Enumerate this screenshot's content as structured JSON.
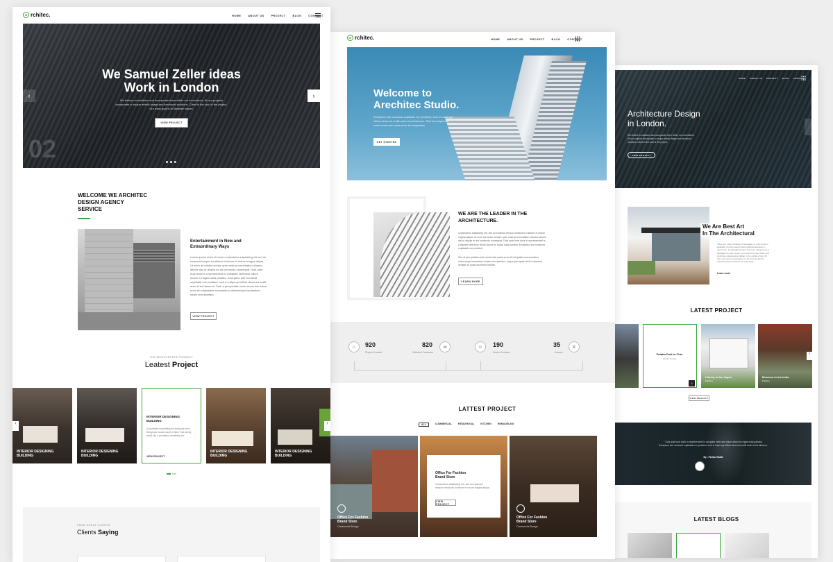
{
  "pages": {
    "left": {
      "logo": "rchitec.",
      "logo_mark": "a",
      "nav": [
        "HOME",
        "ABOUT US",
        "PROJECT",
        "BLOG",
        "CONTACT"
      ],
      "hero": {
        "title_line1": "We Samuel Zeller ideas",
        "title_line2": "Work in London",
        "text_line1": "We believe in traditions and incorporate them within our innovations. All our projects",
        "text_line2": "incorporate a unique artistic image and functional solutions. Client is the soul of the project.",
        "text_line3": "Our main goal is to illustrate values.",
        "button": "VIEW PROJECT",
        "slide_number": "02"
      },
      "welcome": {
        "title_line1": "WELCOME WE ARCHITEC",
        "title_line2": "DESIGN AGENCY",
        "title_line3": "SERVICE",
        "subtitle_line1": "Entertainment in New and",
        "subtitle_line2": "Extraordinary Ways",
        "body": "Lorem ipsum dolor sit amet consectetur adipisicing elit sed do eiusmod tempor incididunt ut labore et dolore magna aliqua Ut enim ad minim veniam quis nostrud exercitation ullamco laboris nisi ut aliquip ex ea commodo consequat. Duis aute irure dolor in reprehenderit in voluptate velit esse cillum dolore eu fugiat nulla pariatur. Excepteur sint occaecat cupidatat non proident, sunt in culpa qui officia deserunt mollit anim id est laborum. Sed ut perspiciatis unde omnis iste natus error sit voluptatem accusantium doloremque laudantium totam rem aperiam.",
        "button": "VIEW PROJECT"
      },
      "projects": {
        "kicker": "THE ARCHITECTER PRODUCT",
        "title_light": "Leatest",
        "title_bold": "Project",
        "items": [
          {
            "label": "INTERIOR DESIGNING BUILDING"
          },
          {
            "label": "INTERIOR DESIGNING BUILDING"
          },
          {
            "label": "INTERIOR DESIGNING BUILDING",
            "text": "A promises something for everyone all in this group would name is New York family that's My 4 promises something for",
            "link": "VIEW PROJECT"
          },
          {
            "label": "INTERIOR DESIGNING BUILDING"
          },
          {
            "label": "INTERIOR DESIGNING BUILDING"
          }
        ]
      },
      "clients": {
        "kicker": "FROM GREAT CLIENTS",
        "title_light": "Clients",
        "title_bold": "Saying"
      }
    },
    "middle": {
      "logo": "rchitec.",
      "logo_mark": "a",
      "nav": [
        "HOME",
        "ABOUT US",
        "PROJECT",
        "BLOG",
        "CONTACT"
      ],
      "hero": {
        "title_line1": "Welcome to",
        "title_line2": "Arechitec Studio.",
        "text_line1": "Excepteur sint occaecat cupidatat non proident, sunt in culpa qui",
        "text_line2": "officia deserunt mollit anim id est laborum. Sed ut perspiciatis",
        "text_line3": "unde omnis iste natus error sit voluptatem",
        "button": "GET STARTED"
      },
      "leader": {
        "title_line1": "WE ARE THE LEADER IN THE",
        "title_line2": "ARCHITECTURE.",
        "body1": "Consectetur adipisicing elit, sed do eiusmod tempor incididunt ut labore et dolore magna aliqua. Ut enim ad minim veniam, quis nostrud exercitation ullamco laboris nisi ut aliquip ex ea commodo consequat. Duis aute irure dolor in reprehenderit in voluptate velit esse cillum dolore eu fugiat nulla pariatur. Excepteur sint occaecat cupidatat non proident.",
        "body2": "Sed ut pers piciatis unde omnis iste natus error sit voluptatem accusantium doloremque laudantium, totam rem aperiam, eaque ipsa quae ab illo inventore veritatis et quasi architecto beatae.",
        "button": "LEARN MORE"
      },
      "stats": [
        {
          "value": "920",
          "label": "Project Created"
        },
        {
          "value": "820",
          "label": "Satisfied Costumes"
        },
        {
          "value": "190",
          "label": "Worker Number"
        },
        {
          "value": "35",
          "label": "Awards"
        }
      ],
      "projects": {
        "title": "LATTEST PROJECT",
        "filters": [
          "ALL",
          "COMMERCIAL",
          "RESIDENTIAL",
          "KITCHEN",
          "REMODELING"
        ],
        "items": [
          {
            "title_line1": "Office For Fashion",
            "title_line2": "Brand Store",
            "sub": "Commercial Design"
          },
          {
            "title_line1": "Office For Fashion",
            "title_line2": "Brand Store",
            "sub": "Consectetur adipisicing elit, sed do eiusmod tempor incididunt ut labore et dolore magna aliqua.",
            "link": "VIEW PROJECT"
          },
          {
            "title_line1": "Office For Fashion",
            "title_line2": "Brand Store",
            "sub": "Commercial Design"
          }
        ]
      }
    },
    "right": {
      "nav": [
        "HOME",
        "ABOUT US",
        "PROJECT",
        "BLOG",
        "CONTACT"
      ],
      "hero": {
        "title_line1": "Architecture Design",
        "title_line2": "in London.",
        "text_line1": "We believe in traditions and incorporate them within our innovations.",
        "text_line2": "All our projects incorporate a unique artistic image and functional",
        "text_line3": "solutions. Client is the soul of the project.",
        "button": "VIEW PROJECT"
      },
      "best_art": {
        "title_line1": "We Are Best Art",
        "title_line2": "In The Architectural",
        "body": "There are many variations of passages of Lorem Ipsum available, but the majority have suffered alteration in some form, by injected humour. If you are going to use a passage of Lorem Ipsum, you need to be sure there isn't anything embarrassing hidden in the middle of text. All the Lorem Ipsum generators on the Internet tend to repeat predefined chunks as necessary.",
        "link": "Learn more"
      },
      "projects": {
        "title": "LATEST PROJECT",
        "items": [
          {
            "title": "Futatio Park in Chin",
            "sub": "Interior Design"
          },
          {
            "title": "Library in the Japan",
            "sub": "Building"
          },
          {
            "title": "Museum in the India",
            "sub": "Building"
          }
        ],
        "button": "VIEW PROJECT"
      },
      "testimonial": {
        "quote_line1": "\" Duis aute irure dolor in reprehenderit in voluptate velit esse cillum dolore eu fugiat nulla pariatur.",
        "quote_line2": "Excepteur sint occaecat cupidatat non proident, sunt in culpa qui officia deserunt mollit anim id est laborum.",
        "author": "By : Farhan Rakib"
      },
      "blogs": {
        "title": "LATEST BLOGS"
      }
    }
  },
  "colors": {
    "accent": "#3aa53a",
    "dark": "#1f2226",
    "blue_sky": "#3e8fb9"
  }
}
